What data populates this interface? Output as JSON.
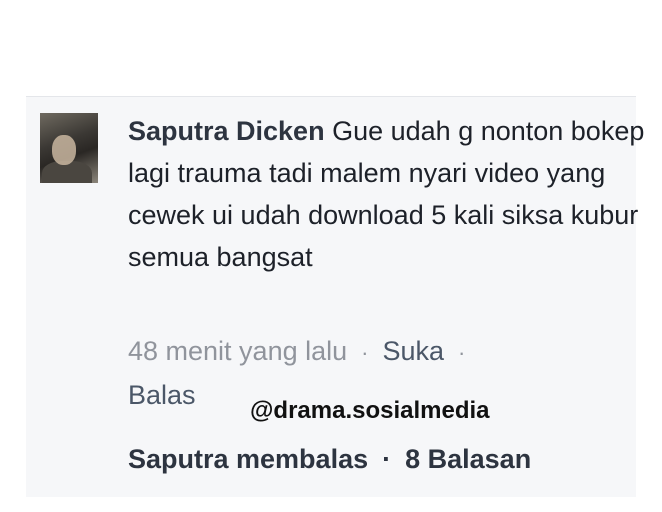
{
  "comment": {
    "author": "Saputra Dicken",
    "text": "Gue udah g nonton bokep lagi trauma tadi malem nyari video yang cewek ui udah download 5 kali siksa kubur semua bangsat",
    "time": "48 menit yang lalu",
    "separator": "·",
    "like_label": "Suka",
    "reply_label": "Balas"
  },
  "watermark": "@drama.sosialmedia",
  "replies": {
    "replier": "Saputra membalas",
    "separator": "·",
    "count_label": "8 Balasan"
  }
}
